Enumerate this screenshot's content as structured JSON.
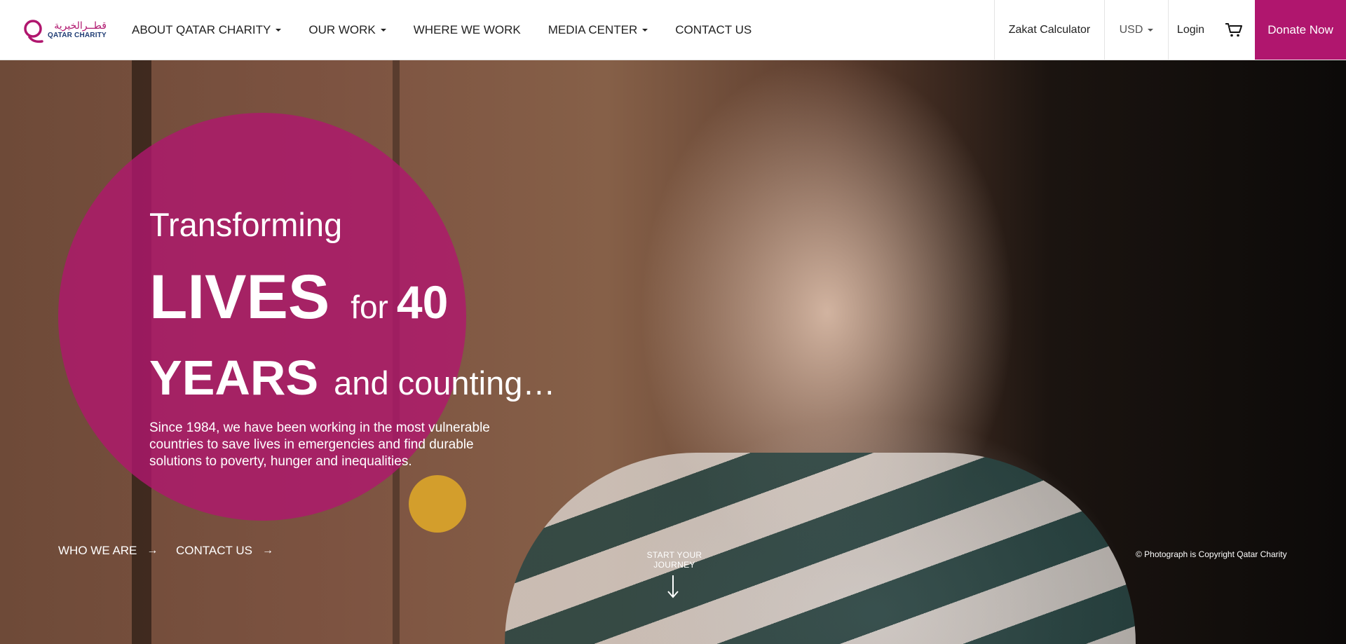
{
  "brand": {
    "name_ar": "قطــرالخيرية",
    "name_en": "QATAR CHARITY",
    "logo_color": "#b0166e",
    "logo_text_color": "#1f3c74"
  },
  "nav": {
    "items": [
      {
        "label": "ABOUT QATAR CHARITY",
        "has_dropdown": true
      },
      {
        "label": "OUR WORK",
        "has_dropdown": true
      },
      {
        "label": "WHERE WE WORK",
        "has_dropdown": false
      },
      {
        "label": "MEDIA CENTER",
        "has_dropdown": true
      },
      {
        "label": "CONTACT US",
        "has_dropdown": false
      }
    ]
  },
  "header_right": {
    "zakat_label": "Zakat Calculator",
    "currency": "USD",
    "login_label": "Login",
    "cart_icon": "cart-icon",
    "donate_label": "Donate Now",
    "donate_color": "#b0166e"
  },
  "hero": {
    "line1": "Transforming",
    "line2_big": "LIVES",
    "line2_for": "for",
    "line2_num": "40",
    "line3_big": "YEARS",
    "line3_rest": "and counting…",
    "description": "Since 1984, we have been working in the most vulnerable countries to save lives in emergencies and find durable solutions to poverty, hunger and inequalities.",
    "cta_who": "WHO WE ARE",
    "cta_contact": "CONTACT US",
    "journey_label": "START YOUR JOURNEY",
    "copyright": "© Photograph is Copyright Qatar Charity",
    "circle_color": "#b0166e",
    "accent_dot_color": "#e2aa28"
  }
}
